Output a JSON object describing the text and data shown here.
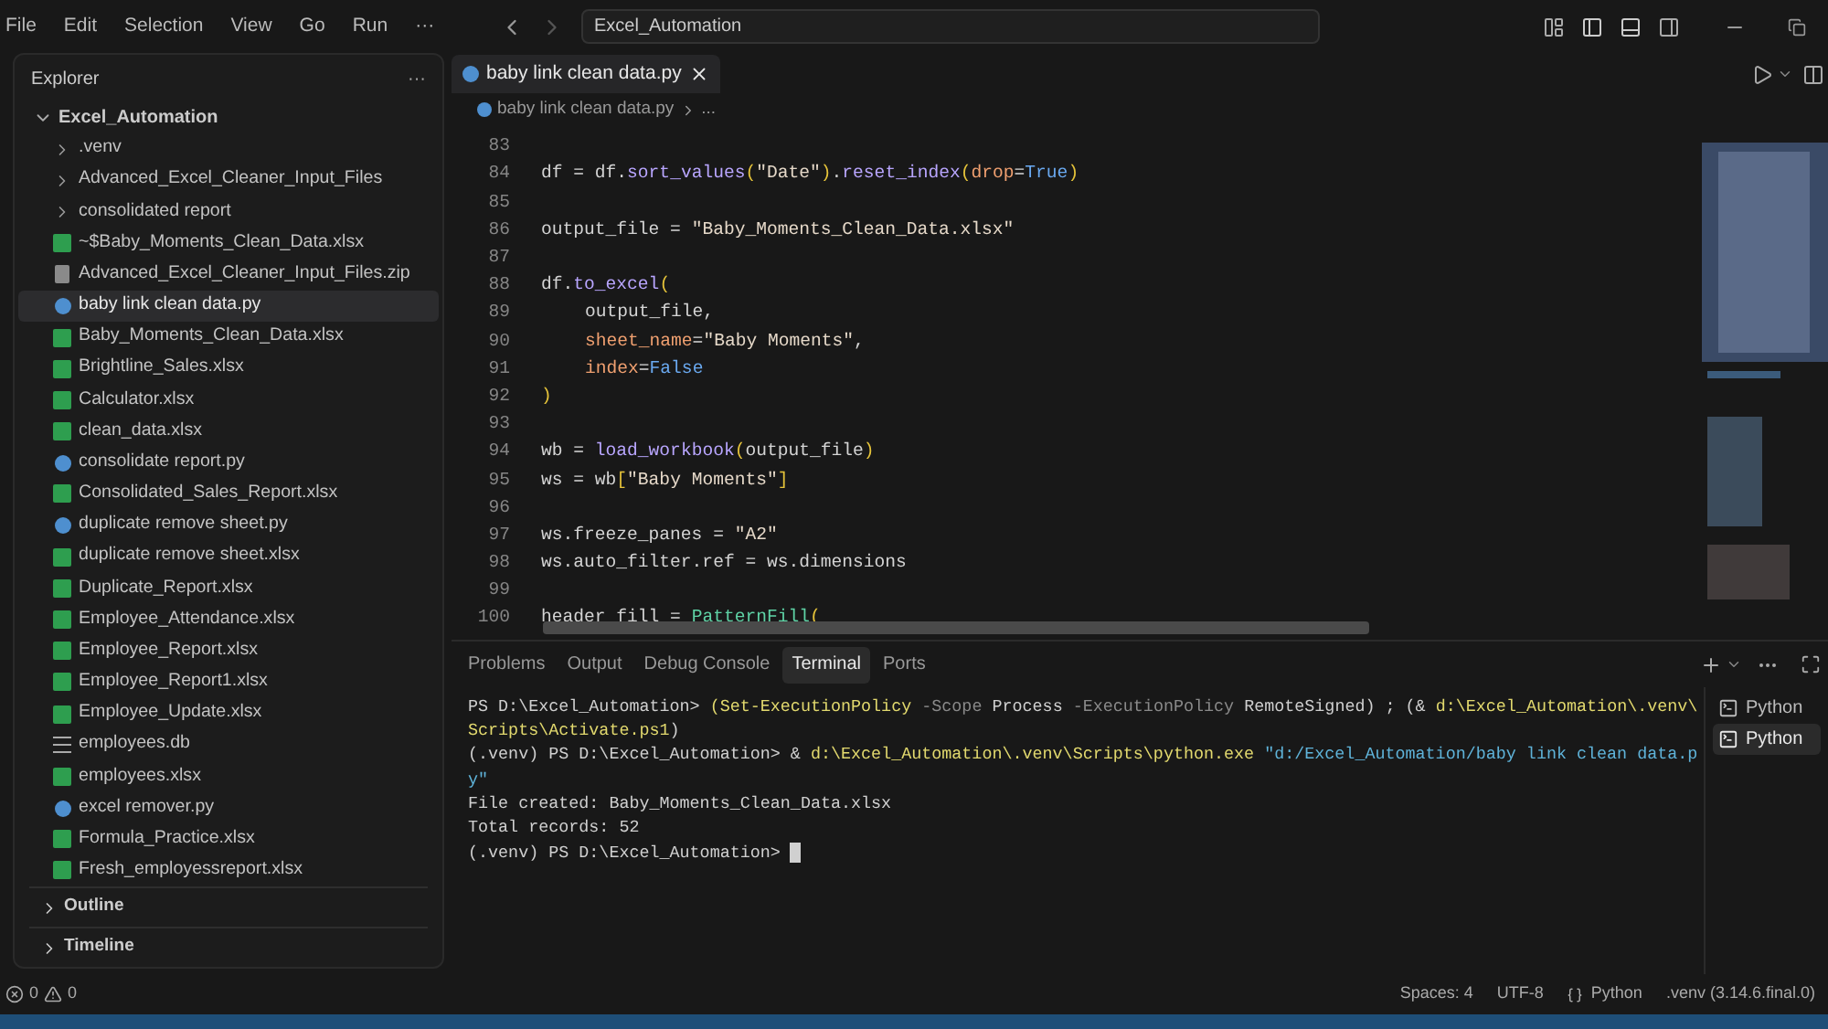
{
  "menu": [
    "File",
    "Edit",
    "Selection",
    "View",
    "Go",
    "Run",
    "···"
  ],
  "command_center": {
    "value": "Excel_Automation"
  },
  "explorer": {
    "title": "Explorer",
    "more": "···",
    "root": {
      "label": "Excel_Automation",
      "expanded": true,
      "children": [
        {
          "label": ".venv",
          "kind": "folder",
          "expanded": false,
          "selected": false
        },
        {
          "label": "Advanced_Excel_Cleaner_Input_Files",
          "kind": "folder",
          "expanded": false,
          "selected": false
        },
        {
          "label": "consolidated report",
          "kind": "folder",
          "expanded": false,
          "selected": false
        },
        {
          "label": "~$Baby_Moments_Clean_Data.xlsx",
          "kind": "excel",
          "selected": false
        },
        {
          "label": "Advanced_Excel_Cleaner_Input_Files.zip",
          "kind": "zip",
          "selected": false
        },
        {
          "label": "baby link clean data.py",
          "kind": "python",
          "selected": true
        },
        {
          "label": "Baby_Moments_Clean_Data.xlsx",
          "kind": "excel",
          "selected": false
        },
        {
          "label": "Brightline_Sales.xlsx",
          "kind": "excel",
          "selected": false
        },
        {
          "label": "Calculator.xlsx",
          "kind": "excel",
          "selected": false
        },
        {
          "label": "clean_data.xlsx",
          "kind": "excel",
          "selected": false
        },
        {
          "label": "consolidate report.py",
          "kind": "python",
          "selected": false
        },
        {
          "label": "Consolidated_Sales_Report.xlsx",
          "kind": "excel",
          "selected": false
        },
        {
          "label": "duplicate remove sheet.py",
          "kind": "python",
          "selected": false
        },
        {
          "label": "duplicate remove sheet.xlsx",
          "kind": "excel",
          "selected": false
        },
        {
          "label": "Duplicate_Report.xlsx",
          "kind": "excel",
          "selected": false
        },
        {
          "label": "Employee_Attendance.xlsx",
          "kind": "excel",
          "selected": false
        },
        {
          "label": "Employee_Report.xlsx",
          "kind": "excel",
          "selected": false
        },
        {
          "label": "Employee_Report1.xlsx",
          "kind": "excel",
          "selected": false
        },
        {
          "label": "Employee_Update.xlsx",
          "kind": "excel",
          "selected": false
        },
        {
          "label": "employees.db",
          "kind": "db",
          "selected": false
        },
        {
          "label": "employees.xlsx",
          "kind": "excel",
          "selected": false
        },
        {
          "label": "excel remover.py",
          "kind": "python",
          "selected": false
        },
        {
          "label": "Formula_Practice.xlsx",
          "kind": "excel",
          "selected": false
        },
        {
          "label": "Fresh_employessreport.xlsx",
          "kind": "excel",
          "selected": false
        }
      ]
    }
  },
  "sections": [
    {
      "label": "Outline",
      "expanded": false
    },
    {
      "label": "Timeline",
      "expanded": false
    }
  ],
  "editor": {
    "tabs": [
      {
        "label": "baby link clean data.py",
        "selected": true
      }
    ],
    "breadcrumb": {
      "file": "baby link clean data.py",
      "rest": "..."
    },
    "lines": [
      {
        "number": "83"
      },
      {
        "number": "84",
        "tokens": [
          {
            "text": "df = df.",
            "kind": "plain"
          },
          {
            "text": "sort_values",
            "kind": "function"
          },
          {
            "text": "(",
            "kind": "bracket"
          },
          {
            "text": "\"Date\"",
            "kind": "string"
          },
          {
            "text": ")",
            "kind": "bracket"
          },
          {
            "text": ".",
            "kind": "plain"
          },
          {
            "text": "reset_index",
            "kind": "function"
          },
          {
            "text": "(",
            "kind": "bracket"
          },
          {
            "text": "drop",
            "kind": "param"
          },
          {
            "text": "=",
            "kind": "plain"
          },
          {
            "text": "True",
            "kind": "constant"
          },
          {
            "text": ")",
            "kind": "bracket"
          }
        ]
      },
      {
        "number": "85"
      },
      {
        "number": "86",
        "tokens": [
          {
            "text": "output_file = ",
            "kind": "plain"
          },
          {
            "text": "\"Baby_Moments_Clean_Data.xlsx\"",
            "kind": "string"
          }
        ]
      },
      {
        "number": "87"
      },
      {
        "number": "88",
        "tokens": [
          {
            "text": "df.",
            "kind": "plain"
          },
          {
            "text": "to_excel",
            "kind": "function"
          },
          {
            "text": "(",
            "kind": "bracket"
          }
        ]
      },
      {
        "number": "89",
        "indented": true,
        "tokens": [
          {
            "text": "output_file,",
            "kind": "plain"
          }
        ]
      },
      {
        "number": "90",
        "indented": true,
        "tokens": [
          {
            "text": "sheet_name",
            "kind": "param"
          },
          {
            "text": "=",
            "kind": "plain"
          },
          {
            "text": "\"Baby Moments\"",
            "kind": "string"
          },
          {
            "text": ",",
            "kind": "plain"
          }
        ]
      },
      {
        "number": "91",
        "indented": true,
        "tokens": [
          {
            "text": "index",
            "kind": "param"
          },
          {
            "text": "=",
            "kind": "plain"
          },
          {
            "text": "False",
            "kind": "constant"
          }
        ]
      },
      {
        "number": "92",
        "tokens": [
          {
            "text": ")",
            "kind": "bracket"
          }
        ]
      },
      {
        "number": "93"
      },
      {
        "number": "94",
        "tokens": [
          {
            "text": "wb = ",
            "kind": "plain"
          },
          {
            "text": "load_workbook",
            "kind": "function"
          },
          {
            "text": "(",
            "kind": "bracket"
          },
          {
            "text": "output_file",
            "kind": "plain"
          },
          {
            "text": ")",
            "kind": "bracket"
          }
        ]
      },
      {
        "number": "95",
        "tokens": [
          {
            "text": "ws = wb",
            "kind": "plain"
          },
          {
            "text": "[",
            "kind": "bracket"
          },
          {
            "text": "\"Baby Moments\"",
            "kind": "string"
          },
          {
            "text": "]",
            "kind": "bracket"
          }
        ]
      },
      {
        "number": "96"
      },
      {
        "number": "97",
        "tokens": [
          {
            "text": "ws.freeze_panes = ",
            "kind": "plain"
          },
          {
            "text": "\"A2\"",
            "kind": "string"
          }
        ]
      },
      {
        "number": "98",
        "tokens": [
          {
            "text": "ws.auto_filter.ref = ws.dimensions",
            "kind": "plain"
          }
        ]
      },
      {
        "number": "99"
      },
      {
        "number": "100",
        "tokens": [
          {
            "text": "header_fill = ",
            "kind": "plain"
          },
          {
            "text": "PatternFill",
            "kind": "class"
          },
          {
            "text": "(",
            "kind": "bracket"
          }
        ]
      }
    ]
  },
  "panel": {
    "tabs": [
      {
        "label": "Problems",
        "selected": false
      },
      {
        "label": "Output",
        "selected": false
      },
      {
        "label": "Debug Console",
        "selected": false
      },
      {
        "label": "Terminal",
        "selected": true
      },
      {
        "label": "Ports",
        "selected": false
      }
    ],
    "terminal": [
      [
        {
          "text": "PS D:\\Excel_Automation> ",
          "kind": "plain"
        },
        {
          "text": "(Set-ExecutionPolicy",
          "kind": "command"
        },
        {
          "text": " -Scope",
          "kind": "flag"
        },
        {
          "text": " Process",
          "kind": "plain"
        },
        {
          "text": " -ExecutionPolicy",
          "kind": "flag"
        },
        {
          "text": " RemoteSigned) ; (& ",
          "kind": "plain"
        },
        {
          "text": "d:\\Excel_Automation\\.venv\\",
          "kind": "command"
        }
      ],
      [
        {
          "text": "Scripts\\Activate.ps1",
          "kind": "command"
        },
        {
          "text": ")",
          "kind": "plain"
        }
      ],
      [
        {
          "text": "(.venv) PS D:\\Excel_Automation> & ",
          "kind": "plain"
        },
        {
          "text": "d:\\Excel_Automation\\.venv\\Scripts\\python.exe",
          "kind": "command"
        },
        {
          "text": " \"d:/Excel_Automation/baby link clean data.p",
          "kind": "string"
        }
      ],
      [
        {
          "text": "y\"",
          "kind": "string"
        }
      ],
      [
        {
          "text": "File created: Baby_Moments_Clean_Data.xlsx",
          "kind": "plain"
        }
      ],
      [
        {
          "text": "Total records: 52",
          "kind": "plain"
        }
      ],
      [
        {
          "text": "(.venv) PS D:\\Excel_Automation> ",
          "kind": "plain"
        }
      ]
    ],
    "terminals": [
      {
        "label": "Python",
        "selected": false
      },
      {
        "label": "Python",
        "selected": true
      }
    ]
  },
  "status": {
    "errors": "0",
    "warnings": "0",
    "items": [
      {
        "label": "Spaces: 4",
        "kind": "text"
      },
      {
        "label": "UTF-8",
        "kind": "text"
      },
      {
        "label": "Python",
        "kind": "language"
      },
      {
        "label": ".venv (3.14.6.final.0)",
        "kind": "text"
      }
    ]
  }
}
